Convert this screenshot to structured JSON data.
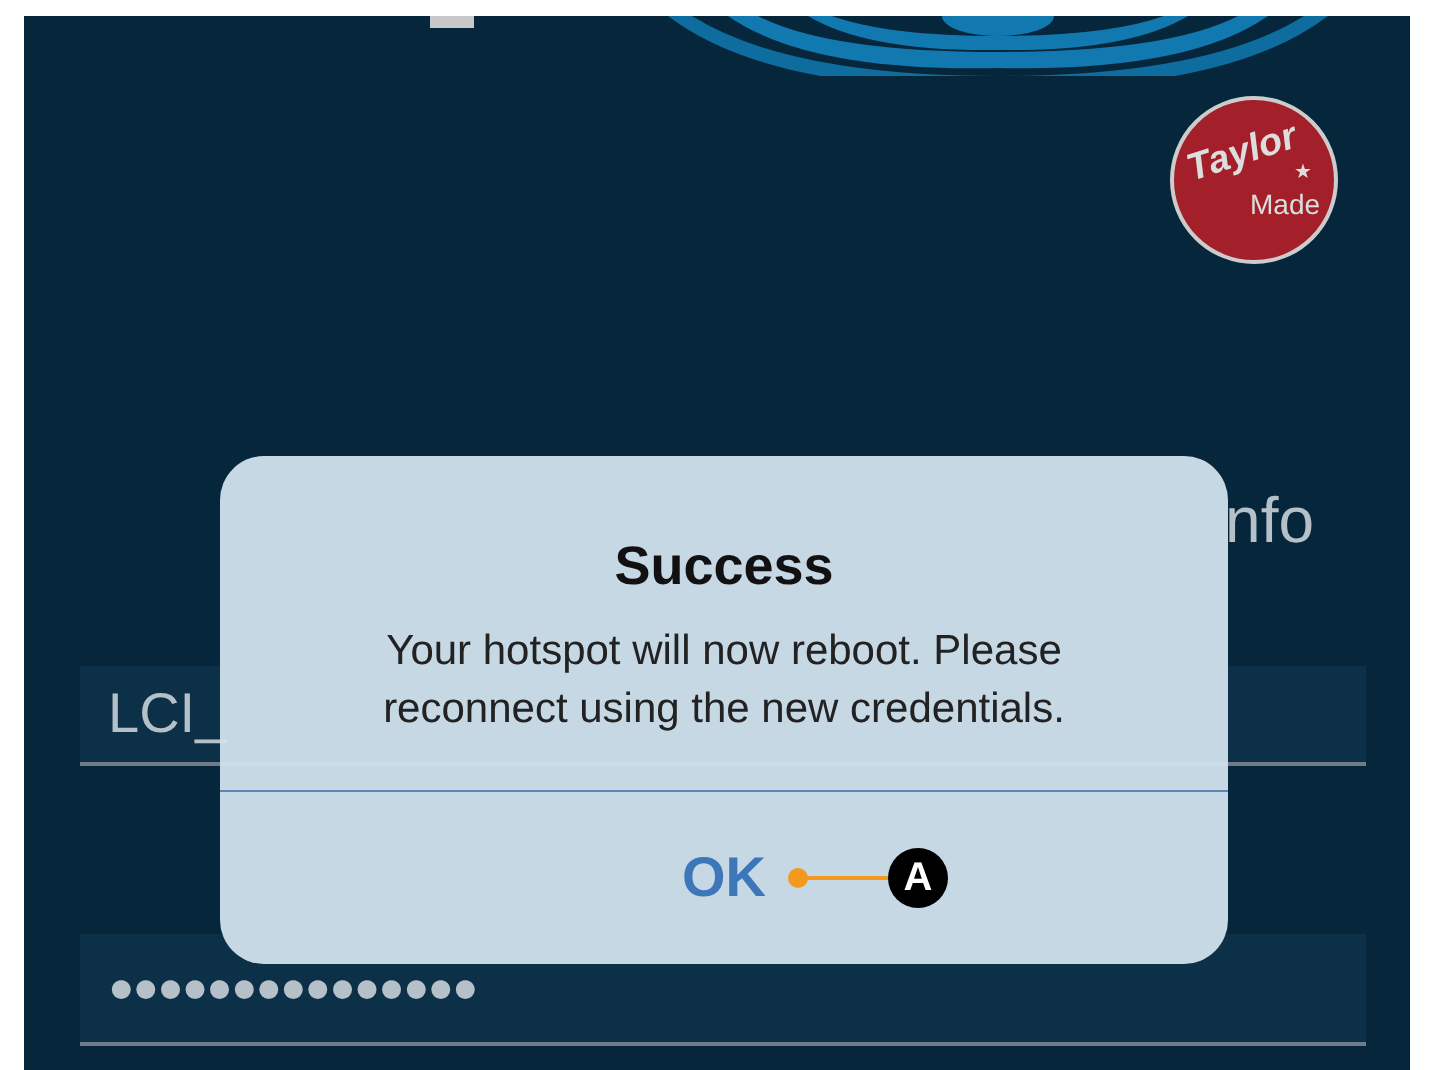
{
  "logo": {
    "line_1": "Taylor",
    "mark": "★",
    "line_2": "Made"
  },
  "heading": "nfo",
  "fields": [
    {
      "kind": "text",
      "value": "LCI_"
    },
    {
      "kind": "password",
      "value": "●●●●●●●●●●●●●●●"
    }
  ],
  "dialog": {
    "title": "Success",
    "message": "Your hotspot will now reboot. Please reconnect using the new credentials.",
    "button": "OK"
  },
  "callout": {
    "label": "A"
  }
}
